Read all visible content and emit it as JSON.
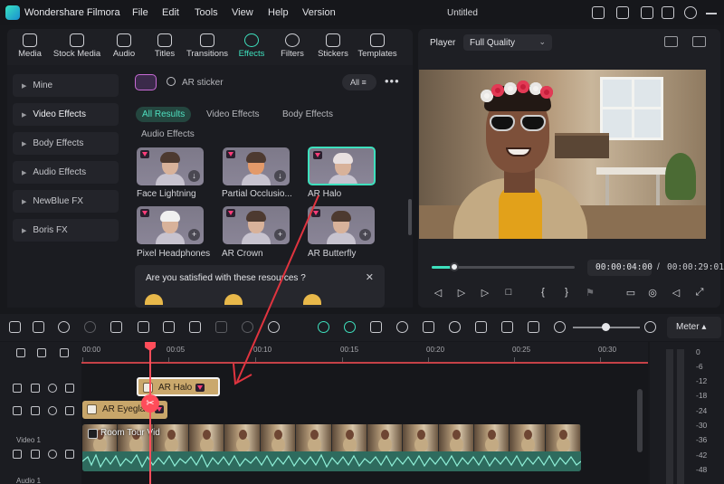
{
  "titlebar": {
    "app_name": "Wondershare Filmora",
    "menu": [
      "File",
      "Edit",
      "Tools",
      "View",
      "Help",
      "Version"
    ],
    "document_title": "Untitled"
  },
  "toolbar": {
    "tools": [
      "Media",
      "Stock Media",
      "Audio",
      "Titles",
      "Transitions",
      "Effects",
      "Filters",
      "Stickers",
      "Templates"
    ],
    "active_tool": "Effects"
  },
  "left_panel": {
    "categories": [
      "Mine",
      "Video Effects",
      "Body Effects",
      "Audio Effects",
      "NewBlue FX",
      "Boris FX"
    ],
    "selected": "Video Effects"
  },
  "resources": {
    "search_value": "AR sticker",
    "filter_label": "All",
    "tabs": [
      "All Results",
      "Video Effects",
      "Body Effects",
      "Audio Effects"
    ],
    "active_tab": "All Results",
    "items": [
      {
        "label": "Face Lightning",
        "action": "download"
      },
      {
        "label": "Partial Occlusio...",
        "action": "download"
      },
      {
        "label": "AR Halo",
        "action": "selected"
      },
      {
        "label": "Pixel Headphones",
        "action": "add"
      },
      {
        "label": "AR Crown",
        "action": "add"
      },
      {
        "label": "AR Butterfly",
        "action": "add"
      }
    ],
    "survey_question": "Are you satisfied with these resources ?",
    "survey_close": "✕"
  },
  "player": {
    "label": "Player",
    "quality": "Full Quality",
    "current_time": "00:00:04:00",
    "separator": "/",
    "total_time": "00:00:29:01",
    "progress_fraction": 0.14
  },
  "timeline": {
    "ruler_labels": [
      "00:00",
      "00:05",
      "00:10",
      "00:15",
      "00:20",
      "00:25",
      "00:30"
    ],
    "clips": {
      "ar_halo": "AR Halo",
      "ar_eyeglass": "AR Eyeglas",
      "video": "Room Tour Vid"
    },
    "track_labels": {
      "video1": "Video 1",
      "audio1": "Audio 1"
    },
    "meter_label": "Meter ▴",
    "meter_db": [
      "0",
      "-6",
      "-12",
      "-18",
      "-24",
      "-30",
      "-36",
      "-42",
      "-48"
    ]
  },
  "colors": {
    "accent": "#3ee0bd",
    "playhead": "#ff4d5a",
    "effect_clip": "#c8a66a",
    "annotation_arrow": "#e0343f"
  }
}
